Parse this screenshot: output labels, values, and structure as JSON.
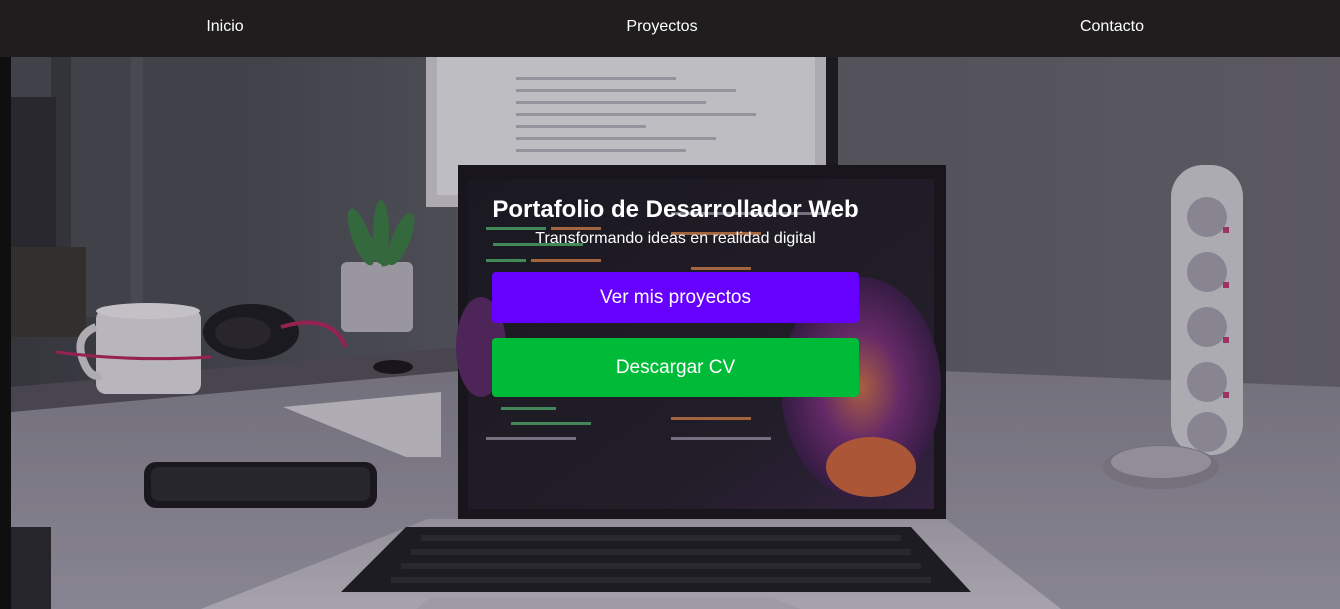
{
  "nav": {
    "items": [
      {
        "label": "Inicio"
      },
      {
        "label": "Proyectos"
      },
      {
        "label": "Contacto"
      }
    ]
  },
  "hero": {
    "background": "laptop-desk-photo",
    "title": "Portafolio de Desarrollador Web",
    "subtitle": "Transformando ideas en realidad digital",
    "primary_button": {
      "label": "Ver mis proyectos"
    },
    "secondary_button": {
      "label": "Descargar CV"
    }
  },
  "colors": {
    "navbar_bg": "#1f1d1d",
    "primary_button": "#6600ff",
    "secondary_button": "#00bb38",
    "text": "#ffffff"
  }
}
